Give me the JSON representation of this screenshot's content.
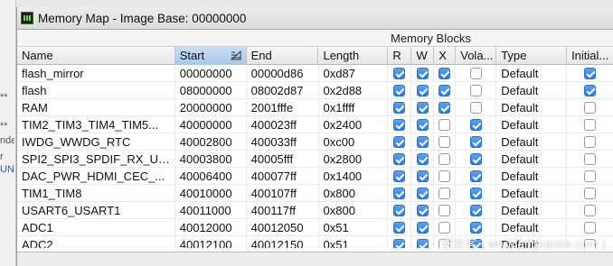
{
  "left_strip": {
    "fragments": [
      "**",
      "**",
      "nde",
      "r",
      "UN"
    ]
  },
  "window": {
    "title": "Memory Map - Image Base: 00000000",
    "icon": "memory-map-icon",
    "group_header": "Memory Blocks",
    "sort_icon": "sort-ascending-icon"
  },
  "columns": [
    "Name",
    "Start",
    "End",
    "Length",
    "R",
    "W",
    "X",
    "Vola...",
    "Type",
    "Initial..."
  ],
  "sorted_column": "Start",
  "rows": [
    {
      "name": "flash_mirror",
      "start": "00000000",
      "end": "00000d86",
      "length": "0xd87",
      "r": true,
      "w": true,
      "x": true,
      "volatile": false,
      "type": "Default",
      "initialized": true
    },
    {
      "name": "flash",
      "start": "08000000",
      "end": "08002d87",
      "length": "0x2d88",
      "r": true,
      "w": true,
      "x": true,
      "volatile": false,
      "type": "Default",
      "initialized": true
    },
    {
      "name": "RAM",
      "start": "20000000",
      "end": "2001fffe",
      "length": "0x1ffff",
      "r": true,
      "w": true,
      "x": true,
      "volatile": false,
      "type": "Default",
      "initialized": false
    },
    {
      "name": "TIM2_TIM3_TIM4_TIM5...",
      "start": "40000000",
      "end": "400023ff",
      "length": "0x2400",
      "r": true,
      "w": true,
      "x": false,
      "volatile": true,
      "type": "Default",
      "initialized": false
    },
    {
      "name": "IWDG_WWDG_RTC",
      "start": "40002800",
      "end": "400033ff",
      "length": "0xc00",
      "r": true,
      "w": true,
      "x": false,
      "volatile": true,
      "type": "Default",
      "initialized": false
    },
    {
      "name": "SPI2_SPI3_SPDIF_RX_US...",
      "start": "40003800",
      "end": "40005fff",
      "length": "0x2800",
      "r": true,
      "w": true,
      "x": false,
      "volatile": true,
      "type": "Default",
      "initialized": false
    },
    {
      "name": "DAC_PWR_HDMI_CEC_...",
      "start": "40006400",
      "end": "400077ff",
      "length": "0x1400",
      "r": true,
      "w": true,
      "x": false,
      "volatile": true,
      "type": "Default",
      "initialized": false
    },
    {
      "name": "TIM1_TIM8",
      "start": "40010000",
      "end": "400107ff",
      "length": "0x800",
      "r": true,
      "w": true,
      "x": false,
      "volatile": true,
      "type": "Default",
      "initialized": false
    },
    {
      "name": "USART6_USART1",
      "start": "40011000",
      "end": "400117ff",
      "length": "0x800",
      "r": true,
      "w": true,
      "x": false,
      "volatile": true,
      "type": "Default",
      "initialized": false
    },
    {
      "name": "ADC1",
      "start": "40012000",
      "end": "40012050",
      "length": "0x51",
      "r": true,
      "w": true,
      "x": false,
      "volatile": true,
      "type": "Default",
      "initialized": false
    },
    {
      "name": "ADC2",
      "start": "40012100",
      "end": "40012150",
      "length": "0x51",
      "r": true,
      "w": true,
      "x": false,
      "volatile": true,
      "type": "Default",
      "initialized": false
    }
  ],
  "watermark": "安全客 ( www.anquanke.com )",
  "colors": {
    "checkbox_checked": "#2b7ce6",
    "sorted_header": "#b6d0ef",
    "titlebar": "#e2e2e2"
  }
}
